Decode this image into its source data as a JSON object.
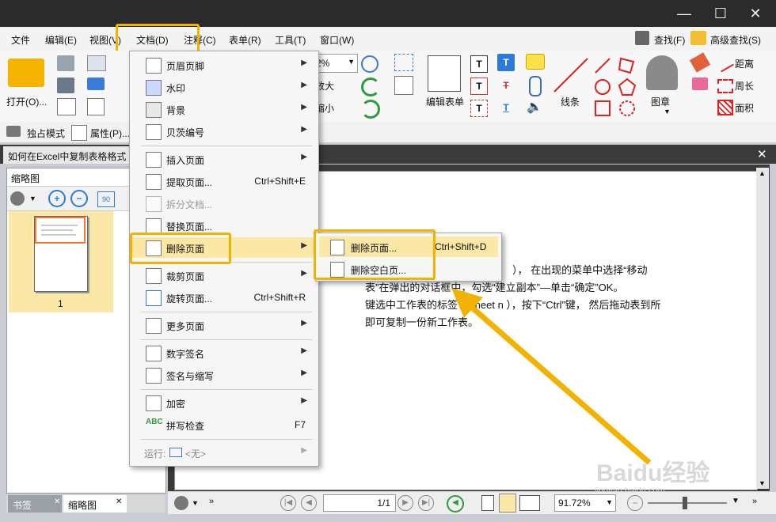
{
  "menubar": {
    "items": [
      "文件",
      "编辑(E)",
      "视图(V)",
      "文档(D)",
      "注释(C)",
      "表单(R)",
      "工具(T)",
      "窗口(W)"
    ],
    "find": "查找(F)",
    "advanced_find": "高级查找(S)"
  },
  "ribbon": {
    "open": "打开(O)...",
    "zoom_value": "2%",
    "enlarge": "放大",
    "shrink": "缩小",
    "edit_form": "编辑表单",
    "line": "线条",
    "stamp": "图章",
    "distance": "距离",
    "perimeter": "周长",
    "area": "面积"
  },
  "toolbar2": {
    "exclusive_mode": "独占模式",
    "properties": "属性(P)..."
  },
  "doc_tab": {
    "title": "如何在Excel中复制表格格式"
  },
  "left_panel": {
    "title": "缩略图",
    "page_number": "1",
    "tabs": [
      "书签",
      "缩略图"
    ]
  },
  "document": {
    "lines": [
      "）， 在出现的菜单中选择“移动",
      "表”在弹出的对话框中，勾选“建立副本”—单击“确定”OK。",
      "键选中工作表的标签（Sheet n ），按下“Ctrl”键， 然后拖动表到所",
      "即可复制一份新工作表。"
    ]
  },
  "status": {
    "page_indicator": "1/1",
    "zoom": "91.72%"
  },
  "dropdown": {
    "items": [
      {
        "label": "页眉页脚",
        "shortcut": "",
        "submenu": true
      },
      {
        "label": "水印",
        "shortcut": "",
        "submenu": true
      },
      {
        "label": "背景",
        "shortcut": "",
        "submenu": true
      },
      {
        "label": "贝茨编号",
        "shortcut": "",
        "submenu": true
      },
      {
        "label": "插入页面",
        "shortcut": "",
        "submenu": true
      },
      {
        "label": "提取页面...",
        "shortcut": "Ctrl+Shift+E",
        "submenu": false
      },
      {
        "label": "拆分文档...",
        "shortcut": "",
        "submenu": false
      },
      {
        "label": "替换页面...",
        "shortcut": "",
        "submenu": false
      },
      {
        "label": "删除页面",
        "shortcut": "",
        "submenu": true
      },
      {
        "label": "裁剪页面",
        "shortcut": "",
        "submenu": true
      },
      {
        "label": "旋转页面...",
        "shortcut": "Ctrl+Shift+R",
        "submenu": false
      },
      {
        "label": "更多页面",
        "shortcut": "",
        "submenu": true
      },
      {
        "label": "数字签名",
        "shortcut": "",
        "submenu": true
      },
      {
        "label": "签名与缩写",
        "shortcut": "",
        "submenu": true
      },
      {
        "label": "加密",
        "shortcut": "",
        "submenu": true
      },
      {
        "label": "拼写检查",
        "shortcut": "F7",
        "submenu": false
      },
      {
        "label": "运行:",
        "shortcut": "",
        "submenu": true
      },
      {
        "label": "<无>",
        "shortcut": "",
        "submenu": false
      }
    ]
  },
  "submenu": {
    "items": [
      {
        "label": "删除页面...",
        "shortcut": "Ctrl+Shift+D"
      },
      {
        "label": "删除空白页...",
        "shortcut": ""
      }
    ]
  },
  "watermark": {
    "text": "Baidu经验",
    "url": "jingyan.baidu.com"
  },
  "colors": {
    "highlight": "#f2b200",
    "menu_hover": "#fbe7a6",
    "titlebar": "#2b2b2b",
    "accent_blue": "#2e7bd6"
  }
}
